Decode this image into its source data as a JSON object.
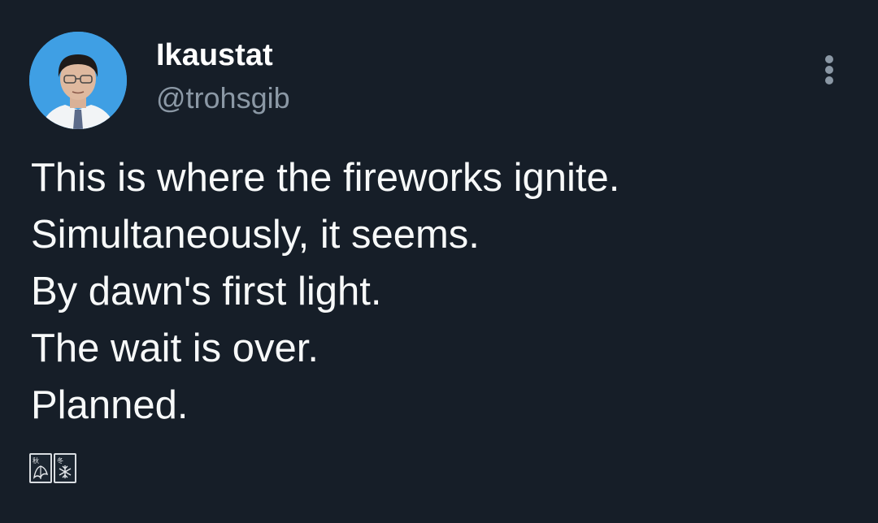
{
  "tweet": {
    "author": {
      "display_name": "Ikaustat",
      "handle": "@trohsgib",
      "avatar_icon": "avatar-photo"
    },
    "more_icon": "more-vertical-icon",
    "text_lines": [
      "This is where the fireworks ignite.",
      "Simultaneously, it seems.",
      "By dawn's first light.",
      "The wait is over.",
      "Planned."
    ],
    "emoji": [
      {
        "icon": "autumn-tile-icon",
        "label": "秋"
      },
      {
        "icon": "winter-tile-icon",
        "label": "冬"
      }
    ]
  },
  "colors": {
    "background": "#161e28",
    "primary_text": "#f7f9f9",
    "secondary_text": "#8b98a5",
    "avatar_bg": "#3f9fe4"
  }
}
